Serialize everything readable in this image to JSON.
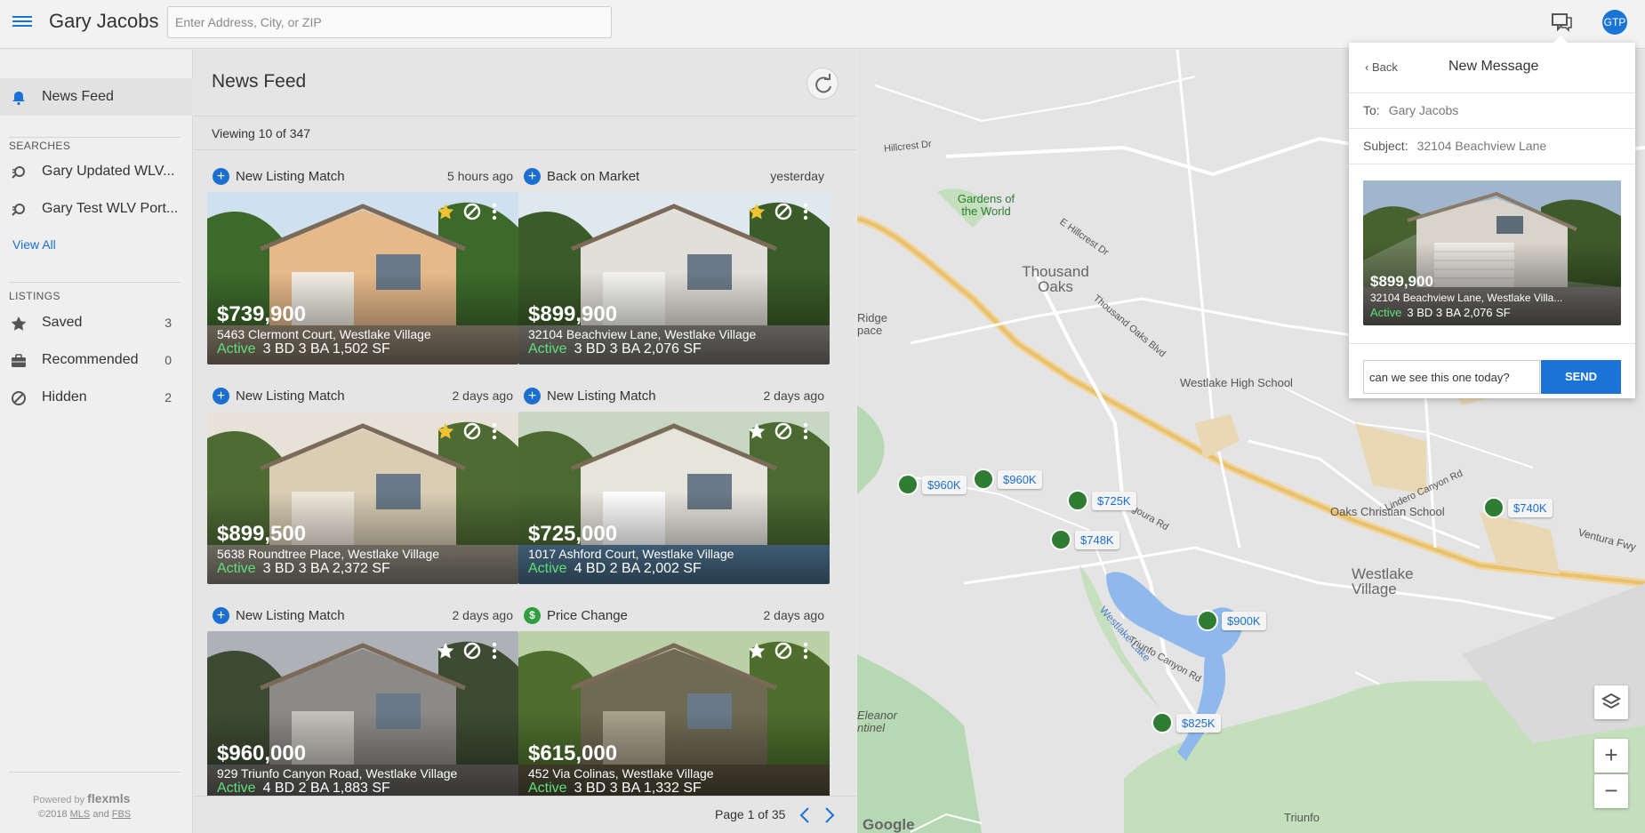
{
  "app": {
    "title": "Gary Jacobs",
    "search_placeholder": "Enter Address, City, or ZIP",
    "avatar": "GTP"
  },
  "sidebar": {
    "news_feed": "News Feed",
    "searches_heading": "SEARCHES",
    "searches": [
      "Gary Updated WLV...",
      "Gary Test WLV Port..."
    ],
    "view_all": "View All",
    "listings_heading": "LISTINGS",
    "listings": [
      {
        "label": "Saved",
        "count": "3",
        "icon": "star-icon"
      },
      {
        "label": "Recommended",
        "count": "0",
        "icon": "briefcase-icon"
      },
      {
        "label": "Hidden",
        "count": "2",
        "icon": "ban-icon"
      }
    ],
    "powered_by": "Powered by",
    "brand": "flexmls",
    "copyright": "©2018",
    "mls": "MLS",
    "and": "and",
    "fbs": "FBS"
  },
  "feed": {
    "title": "News Feed",
    "viewing": "Viewing 10 of 347",
    "page": "Page 1 of 35",
    "cards": [
      {
        "event": "New Listing Match",
        "time": "5 hours ago",
        "price": "$739,900",
        "address": "5463 Clermont Court, Westlake Village",
        "status": "Active",
        "details": "3 BD  3 BA  1,502 SF",
        "starred": true
      },
      {
        "event": "Back on Market",
        "time": "yesterday",
        "price": "$899,900",
        "address": "32104 Beachview Lane, Westlake Village",
        "status": "Active",
        "details": "3 BD  3 BA  2,076 SF",
        "starred": true
      },
      {
        "event": "New Listing Match",
        "time": "2 days ago",
        "price": "$899,500",
        "address": "5638 Roundtree Place, Westlake Village",
        "status": "Active",
        "details": "3 BD  3 BA  2,372 SF",
        "starred": true
      },
      {
        "event": "New Listing Match",
        "time": "2 days ago",
        "price": "$725,000",
        "address": "1017 Ashford Court, Westlake Village",
        "status": "Active",
        "details": "4 BD  2 BA  2,002 SF",
        "starred": false
      },
      {
        "event": "New Listing Match",
        "time": "2 days ago",
        "price": "$960,000",
        "address": "929 Triunfo Canyon Road, Westlake Village",
        "status": "Active",
        "details": "4 BD  2 BA  1,883 SF",
        "starred": false
      },
      {
        "event": "Price Change",
        "time": "2 days ago",
        "price": "$615,000",
        "address": "452 Via Colinas, Westlake Village",
        "status": "Active",
        "details": "3 BD  3 BA  1,332 SF",
        "starred": false
      }
    ]
  },
  "map": {
    "pins": [
      "$960K",
      "$960K",
      "$725K",
      "$748K",
      "$900K",
      "$825K",
      "$740K"
    ],
    "labels": [
      "Gardens of the World",
      "Thousand Oaks",
      "Westlake High School",
      "Oaks Christian School",
      "Westlake Village",
      "Westlake Lake",
      "Ventura Fwy",
      "E Hillcrest Dr",
      "Thousand Oaks Blvd",
      "Agoura Rd",
      "Lindero Canyon Rd",
      "Triunfo Canyon Rd",
      "Ridge pace",
      "Eleanor ntinel",
      "Hillcrest Dr",
      "Triunfo"
    ],
    "google": "Google"
  },
  "message": {
    "back": "Back",
    "title": "New Message",
    "to_label": "To:",
    "to": "Gary Jacobs",
    "subject_label": "Subject:",
    "subject": "32104 Beachview Lane",
    "preview_price": "$899,900",
    "preview_address": "32104 Beachview Lane, Westlake Villa...",
    "preview_status": "Active",
    "preview_details": "3 BD  3 BA  2,076 SF",
    "text": "can we see this one today?",
    "send": "SEND"
  },
  "colors": {
    "accent": "#1a73d6",
    "active_status": "#5fe07a",
    "pin": "#2e7d32"
  }
}
